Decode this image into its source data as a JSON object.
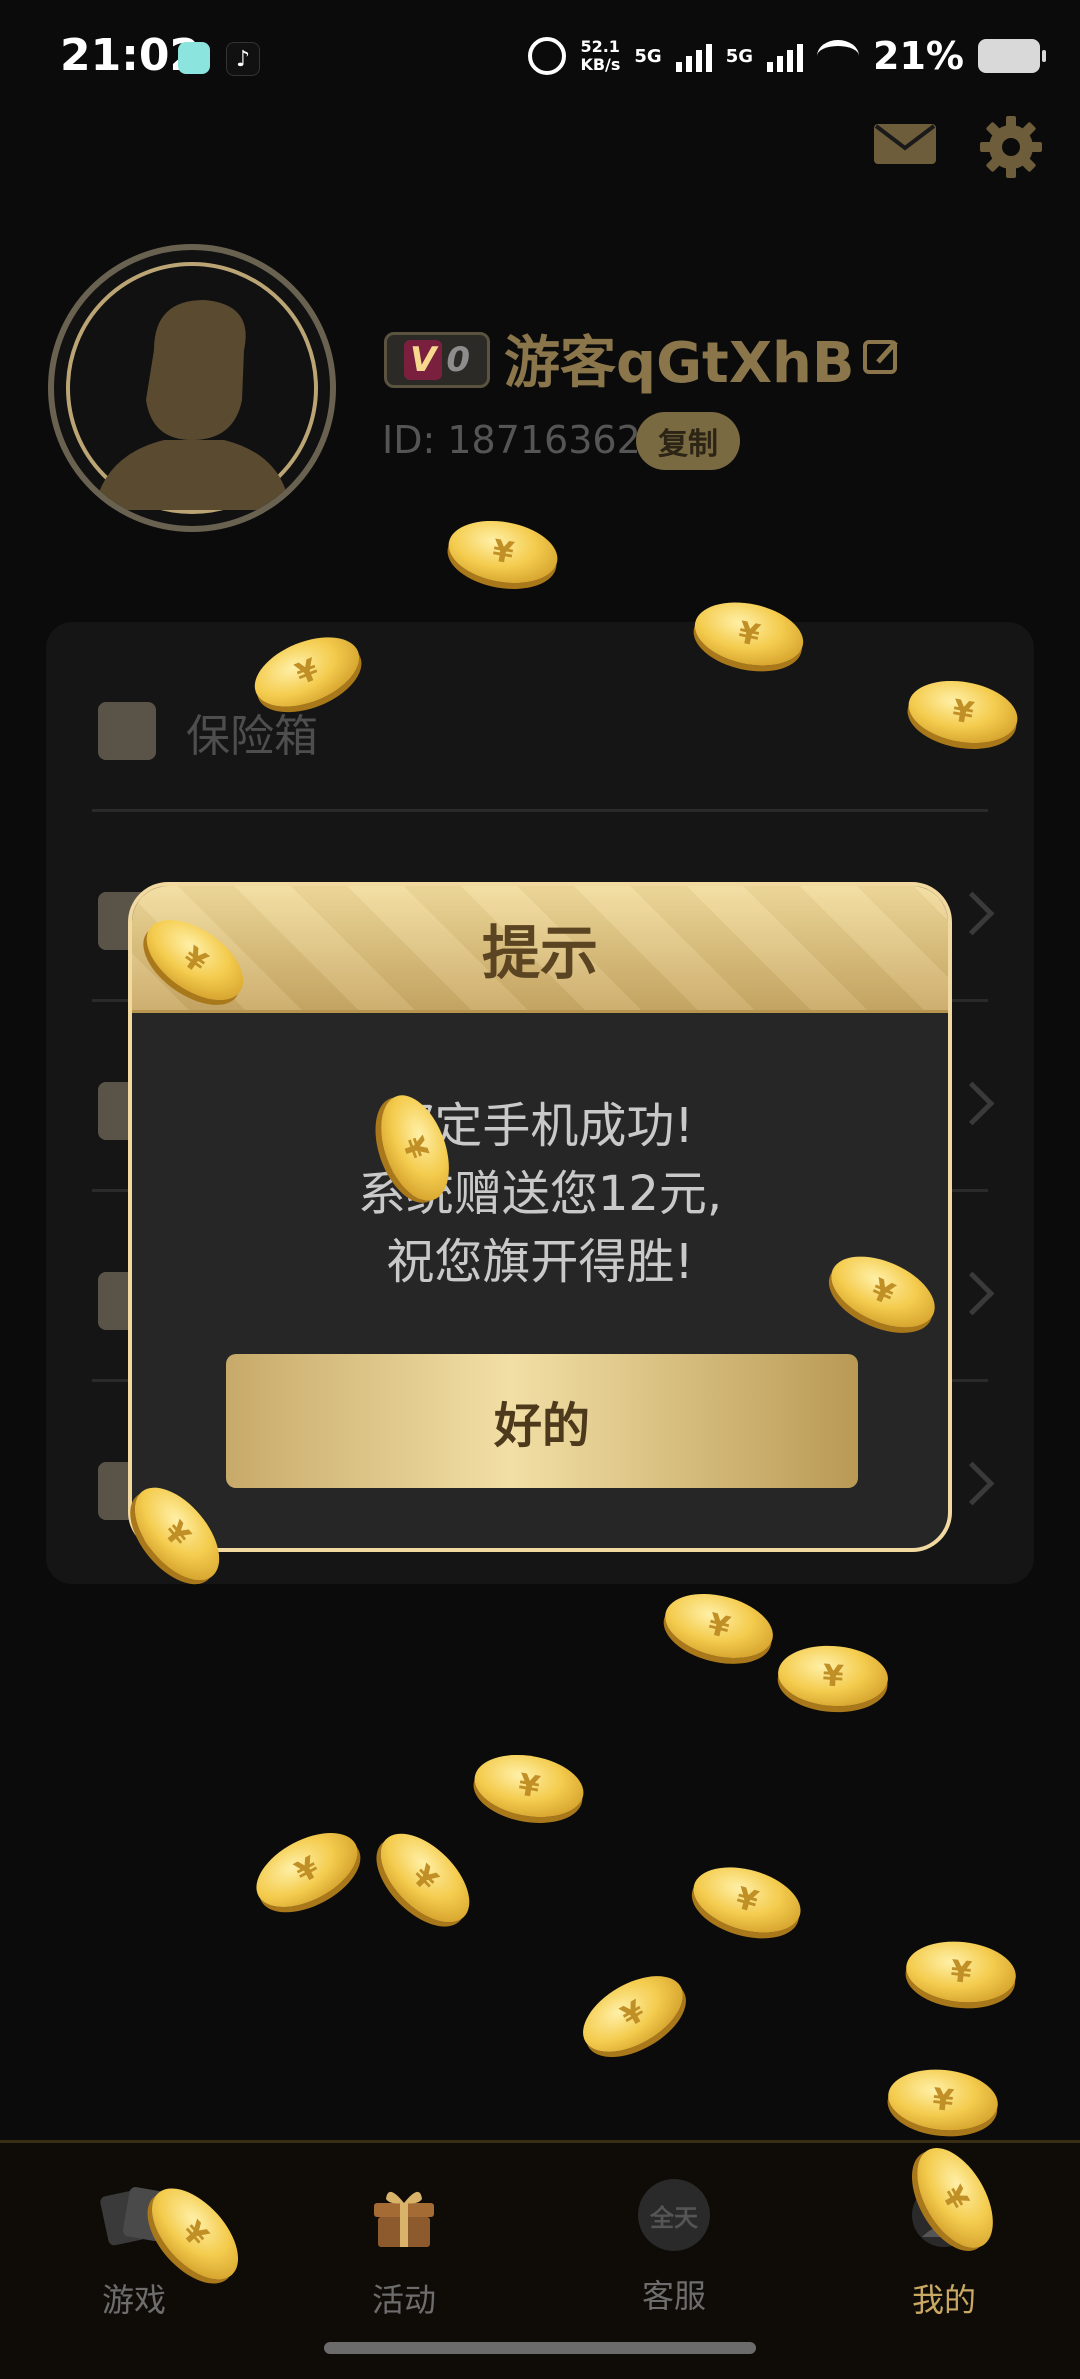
{
  "status_bar": {
    "time": "21:02",
    "speed_value": "52.1",
    "speed_unit": "KB/s",
    "net1": "5G",
    "net2": "5G",
    "battery": "21%",
    "tiktok_glyph": "♪"
  },
  "header": {
    "icons": [
      "mail-icon",
      "gear-icon"
    ]
  },
  "profile": {
    "vip_letter": "V",
    "vip_level": "0",
    "username": "游客qGtXhB",
    "id_text": "ID: 18716362",
    "copy_label": "复制"
  },
  "menu": {
    "items": [
      {
        "label": "保险箱",
        "icon": "safe-icon"
      },
      {
        "label": "",
        "icon": "qr-icon"
      },
      {
        "label": "",
        "icon": "id-card-icon"
      },
      {
        "label": "",
        "icon": "person-icon"
      },
      {
        "label": "",
        "icon": "feedback-icon"
      }
    ]
  },
  "dialog": {
    "title": "提示",
    "line1": "绑定手机成功!",
    "line2": "系统赠送您12元,",
    "line3": "祝您旗开得胜!",
    "ok_label": "好的"
  },
  "coin_symbol": "¥",
  "bottom_nav": {
    "items": [
      {
        "label": "游戏",
        "icon": "cards-icon",
        "active": false
      },
      {
        "label": "活动",
        "icon": "gift-icon",
        "active": false
      },
      {
        "label": "客服",
        "icon": "support-icon",
        "active": false,
        "icon_text": "全天"
      },
      {
        "label": "我的",
        "icon": "profile-icon",
        "active": true
      }
    ]
  },
  "colors": {
    "background": "#0b0b0b",
    "gold": "#c9a864",
    "dialog_border": "#f1d9a0"
  }
}
